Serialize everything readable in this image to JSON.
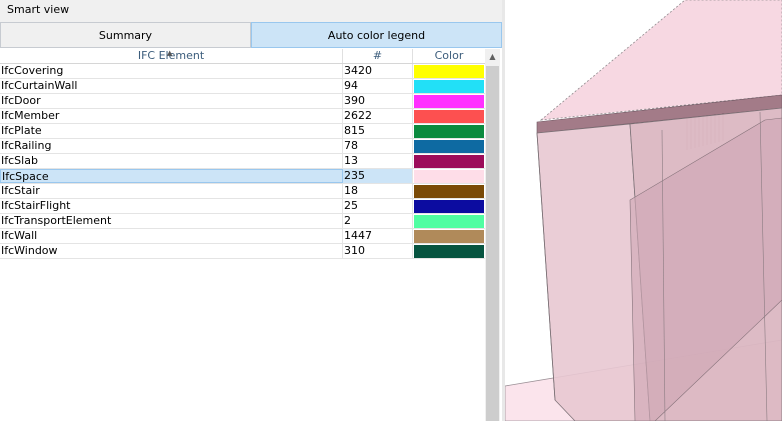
{
  "panel": {
    "title": "Smart view"
  },
  "tabs": [
    {
      "label": "Summary",
      "active": false
    },
    {
      "label": "Auto color legend",
      "active": true
    }
  ],
  "table": {
    "columns": [
      "IFC Element",
      "#",
      "Color"
    ],
    "rows": [
      {
        "element": "IfcCovering",
        "count": "3420",
        "color": "#ffff00"
      },
      {
        "element": "IfcCurtainWall",
        "count": "94",
        "color": "#22e0f7"
      },
      {
        "element": "IfcDoor",
        "count": "390",
        "color": "#ff30ff"
      },
      {
        "element": "IfcMember",
        "count": "2622",
        "color": "#fd5050"
      },
      {
        "element": "IfcPlate",
        "count": "815",
        "color": "#0a8a3e"
      },
      {
        "element": "IfcRailing",
        "count": "78",
        "color": "#0e6aa2"
      },
      {
        "element": "IfcSlab",
        "count": "13",
        "color": "#9c0c5a"
      },
      {
        "element": "IfcSpace",
        "count": "235",
        "color": "#fedde8",
        "selected": true
      },
      {
        "element": "IfcStair",
        "count": "18",
        "color": "#7a4a06"
      },
      {
        "element": "IfcStairFlight",
        "count": "25",
        "color": "#0c0ca0"
      },
      {
        "element": "IfcTransportElement",
        "count": "2",
        "color": "#50fea2"
      },
      {
        "element": "IfcWall",
        "count": "1447",
        "color": "#b08a5a"
      },
      {
        "element": "IfcWindow",
        "count": "310",
        "color": "#065440"
      }
    ]
  },
  "viewport": {
    "background": "#ffffff",
    "space_color": "#f7d8e2",
    "slab_color": "#a37b88"
  }
}
